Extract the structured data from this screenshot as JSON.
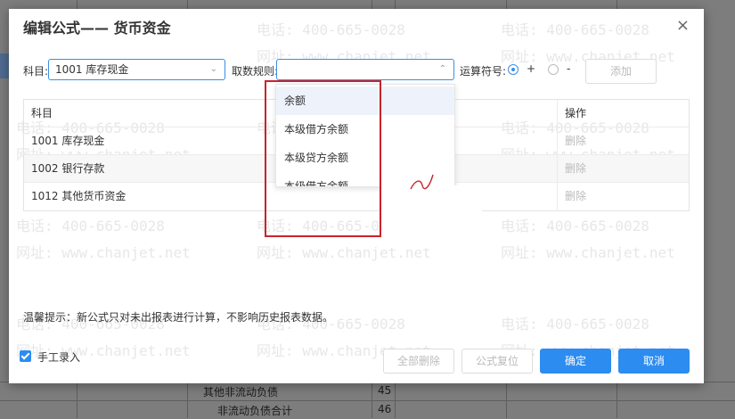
{
  "dialog": {
    "title": "编辑公式—— 货币资金",
    "close_label": "×",
    "subject_label": "科目:",
    "subject_value": "1001 库存现金",
    "rule_label": "取数规则:",
    "rule_value": "",
    "operator_label": "运算符号:",
    "operator_plus": "+",
    "operator_minus": "-",
    "add_label": "添加",
    "table": {
      "headers": [
        "科目",
        "操作"
      ],
      "rows": [
        {
          "subject": "1001 库存现金",
          "action": "删除"
        },
        {
          "subject": "1002 银行存款",
          "action": "删除"
        },
        {
          "subject": "1012 其他货币资金",
          "action": "删除"
        }
      ]
    },
    "dropdown_options": [
      "余额",
      "本级借方余额",
      "本级贷方余额",
      "本级借方余额"
    ],
    "tip": "温馨提示：新公式只对未出报表进行计算，不影响历史报表数据。",
    "manual_entry_label": "手工录入",
    "buttons": {
      "delete_all": "全部删除",
      "reset": "公式复位",
      "confirm": "确定",
      "cancel": "取消"
    }
  },
  "watermark": {
    "phone": "电话: 400-665-0028",
    "site": "网址: www.chanjet.net"
  },
  "background_sheet": {
    "row_label_1": "其他非流动负债",
    "row_num_1": "45",
    "row_label_2": "非流动负债合计",
    "row_num_2": "46"
  },
  "colors": {
    "primary": "#2d8cf0",
    "highlight_box": "#c8232c"
  }
}
